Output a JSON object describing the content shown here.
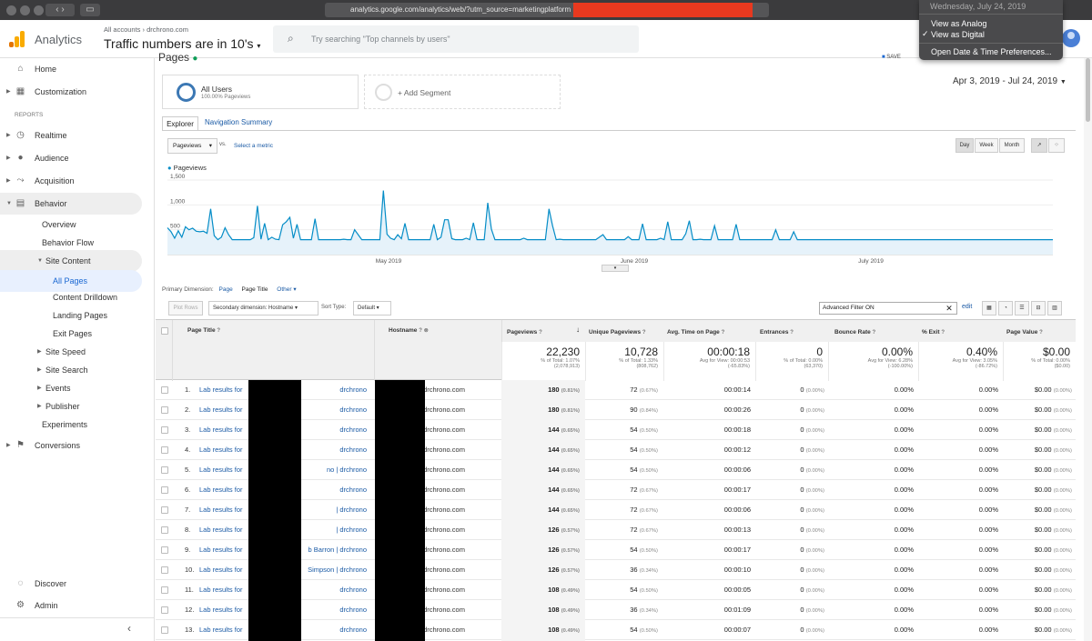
{
  "browser": {
    "url": "analytics.google.com/analytics/web/?utm_source=marketingplatform"
  },
  "header": {
    "product": "Analytics",
    "breadcrumb": [
      "All accounts",
      "drchrono.com"
    ],
    "property_title": "Traffic numbers are in 10's",
    "search_placeholder": "Try searching \"Top channels by users\""
  },
  "clock_menu": {
    "date": "Wednesday, July 24, 2019",
    "items": [
      "View as Analog",
      "View as Digital",
      "Open Date & Time Preferences..."
    ],
    "checked": "View as Digital"
  },
  "sidebar": {
    "home": "Home",
    "customization": "Customization",
    "reports_label": "REPORTS",
    "realtime": "Realtime",
    "audience": "Audience",
    "acquisition": "Acquisition",
    "behavior": "Behavior",
    "overview": "Overview",
    "behavior_flow": "Behavior Flow",
    "site_content": "Site Content",
    "all_pages": "All Pages",
    "content_drilldown": "Content Drilldown",
    "landing_pages": "Landing Pages",
    "exit_pages": "Exit Pages",
    "site_speed": "Site Speed",
    "site_search": "Site Search",
    "events": "Events",
    "publisher": "Publisher",
    "experiments": "Experiments",
    "conversions": "Conversions",
    "discover": "Discover",
    "admin": "Admin"
  },
  "report": {
    "title": "Pages",
    "save": "SAVE",
    "segment_name": "All Users",
    "segment_sub": "100.00% Pageviews",
    "add_segment": "+ Add Segment",
    "date_range": "Apr 3, 2019 - Jul 24, 2019",
    "tabs": [
      "Explorer",
      "Navigation Summary"
    ],
    "metric_select": "Pageviews",
    "vs": "vs.",
    "select_metric": "Select a metric",
    "granularity": [
      "Day",
      "Week",
      "Month"
    ]
  },
  "chart_data": {
    "type": "line",
    "series": [
      {
        "name": "Pageviews",
        "values": [
          540,
          460,
          330,
          480,
          350,
          560,
          500,
          530,
          470,
          460,
          470,
          430,
          920,
          380,
          300,
          350,
          540,
          400,
          300,
          300,
          300,
          300,
          300,
          300,
          340,
          980,
          310,
          630,
          300,
          350,
          310,
          300,
          600,
          660,
          750,
          330,
          610,
          300,
          300,
          300,
          300,
          720,
          300,
          300,
          300,
          300,
          300,
          300,
          300,
          310,
          300,
          300,
          500,
          400,
          300,
          300,
          300,
          300,
          300,
          300,
          1290,
          410,
          330,
          300,
          400,
          320,
          630,
          300,
          300,
          300,
          300,
          300,
          300,
          300,
          610,
          300,
          350,
          700,
          700,
          320,
          300,
          300,
          300,
          330,
          300,
          640,
          300,
          300,
          300,
          1040,
          510,
          300,
          300,
          300,
          300,
          300,
          300,
          300,
          300,
          330,
          300,
          300,
          300,
          300,
          300,
          300,
          920,
          580,
          300,
          310,
          300,
          300,
          300,
          300,
          300,
          300,
          300,
          300,
          300,
          300,
          350,
          400,
          300,
          300,
          300,
          300,
          300,
          300,
          360,
          300,
          300,
          300,
          620,
          300,
          300,
          300,
          300,
          330,
          300,
          660,
          300,
          300,
          300,
          300,
          420,
          680,
          300,
          300,
          310,
          300,
          300,
          300,
          580,
          300,
          300,
          300,
          300,
          300,
          610,
          300,
          300,
          300,
          300,
          300,
          300,
          300,
          300,
          300,
          300,
          500,
          300,
          300,
          300,
          300,
          460,
          300,
          300,
          300,
          300,
          300,
          300,
          300,
          300,
          300,
          300,
          300,
          300,
          300,
          300,
          300,
          300,
          300,
          300,
          300,
          300,
          300,
          300,
          300,
          300,
          300,
          300,
          300,
          300,
          300,
          300,
          300,
          300,
          300,
          300,
          300,
          300,
          300,
          300,
          300,
          300,
          300,
          300,
          300,
          300,
          300,
          300,
          300,
          300,
          300,
          300,
          300,
          300,
          300,
          300,
          300,
          300,
          300,
          300,
          300,
          300,
          300,
          300,
          300,
          300,
          300,
          300,
          300,
          300,
          300,
          300,
          300,
          300
        ]
      }
    ],
    "y_ticks": [
      "1,500",
      "1,000",
      "500"
    ],
    "x_ticks": [
      "May 2019",
      "June 2019",
      "July 2019"
    ],
    "ylim": [
      0,
      1500
    ]
  },
  "dimension_bar": {
    "primary_label": "Primary Dimension:",
    "options": [
      "Page",
      "Page Title",
      "Other"
    ],
    "plot_rows": "Plot Rows",
    "secondary": "Secondary dimension: Hostname",
    "sort_label": "Sort Type:",
    "sort_value": "Default",
    "filter_value": "Advanced Filter ON",
    "edit": "edit"
  },
  "table": {
    "headers": [
      "Page Title",
      "Hostname",
      "Pageviews",
      "Unique Pageviews",
      "Avg. Time on Page",
      "Entrances",
      "Bounce Rate",
      "% Exit",
      "Page Value"
    ],
    "totals": [
      {
        "value": "22,230",
        "sub1": "% of Total: 1.07%",
        "sub2": "(2,078,913)"
      },
      {
        "value": "10,728",
        "sub1": "% of Total: 1.33%",
        "sub2": "(808,762)"
      },
      {
        "value": "00:00:18",
        "sub1": "Avg for View: 00:00:53",
        "sub2": "(-65.83%)"
      },
      {
        "value": "0",
        "sub1": "% of Total: 0.00%",
        "sub2": "(63,370)"
      },
      {
        "value": "0.00%",
        "sub1": "Avg for View: 6.28%",
        "sub2": "(-100.00%)"
      },
      {
        "value": "0.40%",
        "sub1": "Avg for View: 3.05%",
        "sub2": "(-86.72%)"
      },
      {
        "value": "$0.00",
        "sub1": "% of Total: 0.00%",
        "sub2": "($0.00)"
      }
    ],
    "rows": [
      {
        "n": "1.",
        "title_a": "Lab results for",
        "title_b": "drchrono",
        "host": ".drchrono.com",
        "pv": "180",
        "pvp": "(0.81%)",
        "upv": "72",
        "upvp": "(0.67%)",
        "time": "00:00:14",
        "ent": "0",
        "entp": "(0.00%)",
        "br": "0.00%",
        "exit": "0.00%",
        "val": "$0.00",
        "valp": "(0.00%)"
      },
      {
        "n": "2.",
        "title_a": "Lab results for",
        "title_b": "drchrono",
        "host": ".drchrono.com",
        "pv": "180",
        "pvp": "(0.81%)",
        "upv": "90",
        "upvp": "(0.84%)",
        "time": "00:00:26",
        "ent": "0",
        "entp": "(0.00%)",
        "br": "0.00%",
        "exit": "0.00%",
        "val": "$0.00",
        "valp": "(0.00%)"
      },
      {
        "n": "3.",
        "title_a": "Lab results for",
        "title_b": "drchrono",
        "host": ".drchrono.com",
        "pv": "144",
        "pvp": "(0.65%)",
        "upv": "54",
        "upvp": "(0.50%)",
        "time": "00:00:18",
        "ent": "0",
        "entp": "(0.00%)",
        "br": "0.00%",
        "exit": "0.00%",
        "val": "$0.00",
        "valp": "(0.00%)"
      },
      {
        "n": "4.",
        "title_a": "Lab results for",
        "title_b": "drchrono",
        "host": ".drchrono.com",
        "pv": "144",
        "pvp": "(0.65%)",
        "upv": "54",
        "upvp": "(0.50%)",
        "time": "00:00:12",
        "ent": "0",
        "entp": "(0.00%)",
        "br": "0.00%",
        "exit": "0.00%",
        "val": "$0.00",
        "valp": "(0.00%)"
      },
      {
        "n": "5.",
        "title_a": "Lab results for",
        "title_b": "no | drchrono",
        "host": ".drchrono.com",
        "pv": "144",
        "pvp": "(0.65%)",
        "upv": "54",
        "upvp": "(0.50%)",
        "time": "00:00:06",
        "ent": "0",
        "entp": "(0.00%)",
        "br": "0.00%",
        "exit": "0.00%",
        "val": "$0.00",
        "valp": "(0.00%)"
      },
      {
        "n": "6.",
        "title_a": "Lab results for",
        "title_b": "drchrono",
        "host": ".drchrono.com",
        "pv": "144",
        "pvp": "(0.65%)",
        "upv": "72",
        "upvp": "(0.67%)",
        "time": "00:00:17",
        "ent": "0",
        "entp": "(0.00%)",
        "br": "0.00%",
        "exit": "0.00%",
        "val": "$0.00",
        "valp": "(0.00%)"
      },
      {
        "n": "7.",
        "title_a": "Lab results for",
        "title_b": "| drchrono",
        "host": ".drchrono.com",
        "pv": "144",
        "pvp": "(0.65%)",
        "upv": "72",
        "upvp": "(0.67%)",
        "time": "00:00:06",
        "ent": "0",
        "entp": "(0.00%)",
        "br": "0.00%",
        "exit": "0.00%",
        "val": "$0.00",
        "valp": "(0.00%)"
      },
      {
        "n": "8.",
        "title_a": "Lab results for",
        "title_b": "| drchrono",
        "host": ".drchrono.com",
        "pv": "126",
        "pvp": "(0.57%)",
        "upv": "72",
        "upvp": "(0.67%)",
        "time": "00:00:13",
        "ent": "0",
        "entp": "(0.00%)",
        "br": "0.00%",
        "exit": "0.00%",
        "val": "$0.00",
        "valp": "(0.00%)"
      },
      {
        "n": "9.",
        "title_a": "Lab results for",
        "title_b": "b Barron | drchrono",
        "host": ".drchrono.com",
        "pv": "126",
        "pvp": "(0.57%)",
        "upv": "54",
        "upvp": "(0.50%)",
        "time": "00:00:17",
        "ent": "0",
        "entp": "(0.00%)",
        "br": "0.00%",
        "exit": "0.00%",
        "val": "$0.00",
        "valp": "(0.00%)"
      },
      {
        "n": "10.",
        "title_a": "Lab results for",
        "title_b": "Simpson | drchrono",
        "host": ".drchrono.com",
        "pv": "126",
        "pvp": "(0.57%)",
        "upv": "36",
        "upvp": "(0.34%)",
        "time": "00:00:10",
        "ent": "0",
        "entp": "(0.00%)",
        "br": "0.00%",
        "exit": "0.00%",
        "val": "$0.00",
        "valp": "(0.00%)"
      },
      {
        "n": "11.",
        "title_a": "Lab results for",
        "title_b": "drchrono",
        "host": ".drchrono.com",
        "pv": "108",
        "pvp": "(0.49%)",
        "upv": "54",
        "upvp": "(0.50%)",
        "time": "00:00:05",
        "ent": "0",
        "entp": "(0.00%)",
        "br": "0.00%",
        "exit": "0.00%",
        "val": "$0.00",
        "valp": "(0.00%)"
      },
      {
        "n": "12.",
        "title_a": "Lab results for",
        "title_b": "drchrono",
        "host": ".drchrono.com",
        "pv": "108",
        "pvp": "(0.49%)",
        "upv": "36",
        "upvp": "(0.34%)",
        "time": "00:01:09",
        "ent": "0",
        "entp": "(0.00%)",
        "br": "0.00%",
        "exit": "0.00%",
        "val": "$0.00",
        "valp": "(0.00%)"
      },
      {
        "n": "13.",
        "title_a": "Lab results for",
        "title_b": "drchrono",
        "host": ".drchrono.com",
        "pv": "108",
        "pvp": "(0.49%)",
        "upv": "54",
        "upvp": "(0.50%)",
        "time": "00:00:07",
        "ent": "0",
        "entp": "(0.00%)",
        "br": "0.00%",
        "exit": "0.00%",
        "val": "$0.00",
        "valp": "(0.00%)"
      }
    ]
  }
}
